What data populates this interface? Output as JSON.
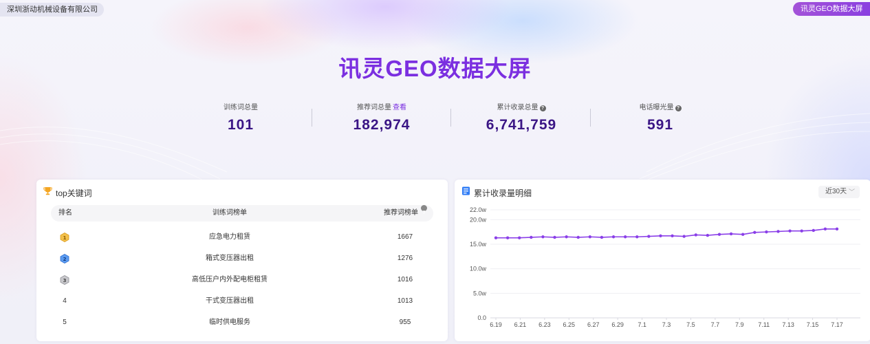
{
  "company": "深圳浙动机械设备有限公司",
  "top_button": "讯灵GEO数据大屏",
  "title": "讯灵GEO数据大屏",
  "stats": [
    {
      "label": "训练词总量",
      "value": "101"
    },
    {
      "label": "推荐词总量",
      "link": "查看",
      "value": "182,974"
    },
    {
      "label": "累计收录总量",
      "value": "6,741,759",
      "help": "?"
    },
    {
      "label": "电话曝光量",
      "value": "591",
      "help": "?"
    }
  ],
  "top_keywords": {
    "title": "top关键词",
    "icon": "trophy-icon",
    "columns": {
      "rank": "排名",
      "keyword": "训练词榜单",
      "count": "推荐词榜单",
      "help": "?"
    },
    "rows": [
      {
        "rank": "1",
        "keyword": "应急电力租赁",
        "count": "1667",
        "medal": "gold"
      },
      {
        "rank": "2",
        "keyword": "箱式变压器出租",
        "count": "1276",
        "medal": "blue"
      },
      {
        "rank": "3",
        "keyword": "高低压户内外配电柜租赁",
        "count": "1016",
        "medal": "silver"
      },
      {
        "rank": "4",
        "keyword": "干式变压器出租",
        "count": "1013"
      },
      {
        "rank": "5",
        "keyword": "临时供电服务",
        "count": "955"
      }
    ]
  },
  "detail": {
    "title": "累计收录量明细",
    "icon": "document-icon",
    "range": "近30天",
    "range_chevron": "﹀"
  },
  "colors": {
    "accent": "#7b2fe0",
    "line": "#8a3fe8",
    "value": "#3a1585"
  },
  "chart_data": {
    "type": "line",
    "x": [
      "6.19",
      "6.20",
      "6.21",
      "6.22",
      "6.23",
      "6.24",
      "6.25",
      "6.26",
      "6.27",
      "6.28",
      "6.29",
      "6.30",
      "7.1",
      "7.2",
      "7.3",
      "7.4",
      "7.5",
      "7.6",
      "7.7",
      "7.8",
      "7.9",
      "7.10",
      "7.11",
      "7.12",
      "7.13",
      "7.14",
      "7.15",
      "7.16",
      "7.17"
    ],
    "x_ticks": [
      "6.19",
      "6.21",
      "6.23",
      "6.25",
      "6.27",
      "6.29",
      "7.1",
      "7.3",
      "7.5",
      "7.7",
      "7.9",
      "7.11",
      "7.13",
      "7.15",
      "7.17"
    ],
    "y_ticks": [
      {
        "value": 0,
        "label": "0.0"
      },
      {
        "value": 5,
        "label": "5.0w"
      },
      {
        "value": 10,
        "label": "10.0w"
      },
      {
        "value": 15,
        "label": "15.0w"
      },
      {
        "value": 20,
        "label": "20.0w"
      },
      {
        "value": 22,
        "label": "22.0w"
      }
    ],
    "ylim": [
      0,
      22
    ],
    "series": [
      {
        "values": [
          16.3,
          16.3,
          16.3,
          16.4,
          16.5,
          16.4,
          16.5,
          16.4,
          16.5,
          16.4,
          16.5,
          16.5,
          16.5,
          16.6,
          16.7,
          16.7,
          16.6,
          16.9,
          16.8,
          17.0,
          17.1,
          17.0,
          17.4,
          17.5,
          17.6,
          17.7,
          17.7,
          17.8,
          18.1,
          18.1
        ]
      }
    ],
    "grid": true
  }
}
